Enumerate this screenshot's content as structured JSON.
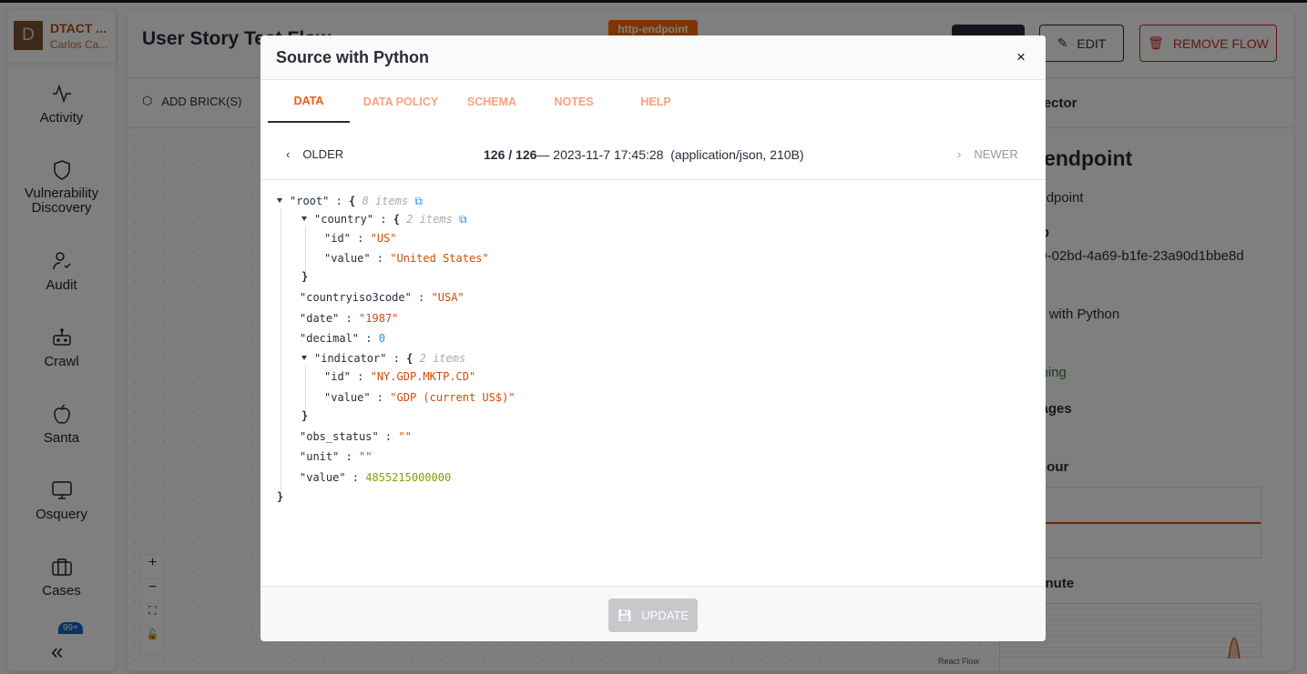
{
  "sidebar": {
    "org_initial": "D",
    "org_name": "DTACT ...",
    "user_name": "Carlos Ca...",
    "items": [
      {
        "label": "Activity",
        "icon": "activity-icon"
      },
      {
        "label": "Vulnerability Discovery",
        "icon": "shield-icon"
      },
      {
        "label": "Audit",
        "icon": "user-check-icon"
      },
      {
        "label": "Crawl",
        "icon": "robot-icon"
      },
      {
        "label": "Santa",
        "icon": "apple-icon"
      },
      {
        "label": "Osquery",
        "icon": "monitor-icon"
      },
      {
        "label": "Cases",
        "icon": "briefcase-icon"
      }
    ],
    "notifications_badge": "99+",
    "collapse_label": "«"
  },
  "header": {
    "title": "User Story Test Flow",
    "edit_label": "EDIT",
    "remove_label": "REMOVE FLOW",
    "add_bricks_label": "ADD BRICK(S)"
  },
  "canvas": {
    "node_tag": "http-endpoint",
    "attribution": "React Flow",
    "controls": [
      "+",
      "−"
    ]
  },
  "inspector": {
    "title": "Inspector",
    "node_title": "http-endpoint",
    "node_type": "http-endpoint",
    "id_label": "ID",
    "id_value": "09-02bd-4a69-b1fe-23a90d1bbe8d",
    "brick": "Source with Python",
    "status": "Running",
    "messages_label": "Messages",
    "last_hour_label": "Last hour",
    "last_minute_label": "Last minute"
  },
  "modal": {
    "title": "Source with Python",
    "tabs": [
      "DATA",
      "DATA POLICY",
      "SCHEMA",
      "NOTES",
      "HELP"
    ],
    "active_tab": "DATA",
    "older_label": "OLDER",
    "newer_label": "NEWER",
    "position": "126 / 126",
    "timestamp": "— 2023-11-7 17:45:28",
    "content_info": "(application/json, 210B)",
    "update_label": "UPDATE",
    "json": {
      "root_key": "\"root\"",
      "root_count": "8 items",
      "country_key": "\"country\"",
      "country_count": "2 items",
      "country_id_key": "\"id\"",
      "country_id_val": "\"US\"",
      "country_value_key": "\"value\"",
      "country_value_val": "\"United States\"",
      "iso_key": "\"countryiso3code\"",
      "iso_val": "\"USA\"",
      "date_key": "\"date\"",
      "date_val": "\"1987\"",
      "decimal_key": "\"decimal\"",
      "decimal_val": "0",
      "indicator_key": "\"indicator\"",
      "indicator_count": "2 items",
      "indicator_id_key": "\"id\"",
      "indicator_id_val": "\"NY.GDP.MKTP.CD\"",
      "indicator_value_key": "\"value\"",
      "indicator_value_val": "\"GDP (current US$)\"",
      "obs_key": "\"obs_status\"",
      "obs_val": "\"\"",
      "unit_key": "\"unit\"",
      "unit_val": "\"\"",
      "value_key": "\"value\"",
      "value_val": "4855215000000"
    }
  },
  "colors": {
    "accent": "#f05a12",
    "danger": "#c62828",
    "success": "#2e7d32"
  }
}
